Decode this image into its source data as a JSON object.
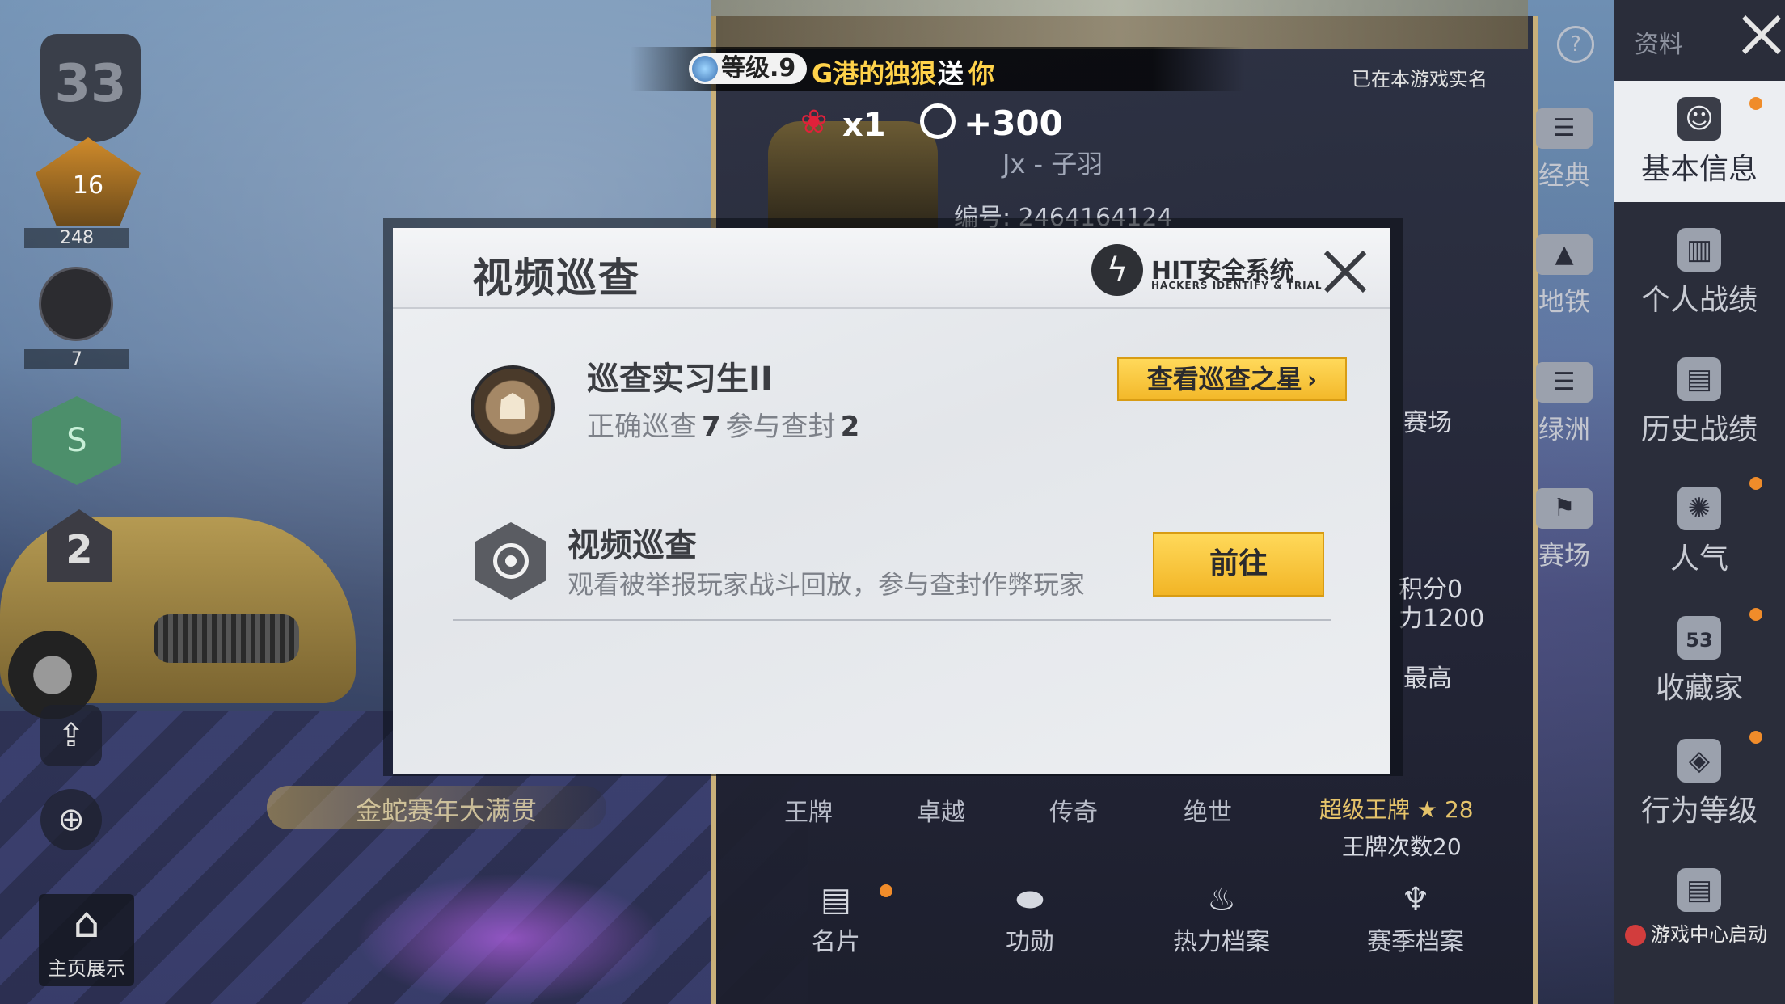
{
  "gift": {
    "level_badge": "等级.9",
    "sender": "G港的独狠",
    "verb": "送",
    "target": "你",
    "count": "x1",
    "points": "+300"
  },
  "profile": {
    "realname_notice": "已在本游戏实名",
    "player_id": "编号: 2464164124",
    "player_name": "Jx - 子羽",
    "stats": {
      "arena": "赛场",
      "score": "积分0",
      "power": "力1200",
      "highest": "最高"
    },
    "tiers": [
      "王牌",
      "卓越",
      "传奇",
      "绝世"
    ],
    "tier_highlight": "超级王牌",
    "tier_stars": "28",
    "tier_count": "王牌次数20"
  },
  "bottom_tabs": [
    {
      "label": "名片",
      "icon": "card-icon"
    },
    {
      "label": "功勋",
      "icon": "medal-icon"
    },
    {
      "label": "热力档案",
      "icon": "flame-icon"
    },
    {
      "label": "赛季档案",
      "icon": "season-icon"
    }
  ],
  "sidebar": {
    "header": "资料",
    "items": [
      {
        "label": "基本信息",
        "icon": "profile-icon"
      },
      {
        "label": "个人战绩",
        "icon": "stats-icon"
      },
      {
        "label": "历史战绩",
        "icon": "history-icon"
      },
      {
        "label": "人气",
        "icon": "popularity-icon"
      },
      {
        "label": "收藏家",
        "icon": "collector-icon",
        "badge": "53"
      },
      {
        "label": "行为等级",
        "icon": "behavior-icon"
      }
    ],
    "game_center": "游戏中心启动"
  },
  "sub_tabs": [
    {
      "label": "经典"
    },
    {
      "label": "地铁"
    },
    {
      "label": "绿洲"
    },
    {
      "label": "赛场"
    }
  ],
  "hud": {
    "level": "33",
    "rank_number": "16",
    "rank_count": "248",
    "circle_count": "7",
    "hex_label": "S",
    "badge_number": "2",
    "home_label": "主页展示",
    "event_text": "金蛇赛年大满贯"
  },
  "dialog": {
    "title": "视频巡查",
    "brand": "HIT安全系统",
    "brand_sub": "HACKERS IDENTIFY & TRIAL",
    "rank_title": "巡查实习生II",
    "stat_correct_label": "正确巡查",
    "stat_correct_value": "7",
    "stat_ban_label": "参与查封",
    "stat_ban_value": "2",
    "star_button": "查看巡查之星",
    "patrol_title": "视频巡查",
    "patrol_desc": "观看被举报玩家战斗回放，参与查封作弊玩家",
    "go_button": "前往"
  },
  "colors": {
    "accent_yellow": "#f3b82a",
    "gold_text": "#ffd24a",
    "dialog_bg": "#eceef1"
  }
}
